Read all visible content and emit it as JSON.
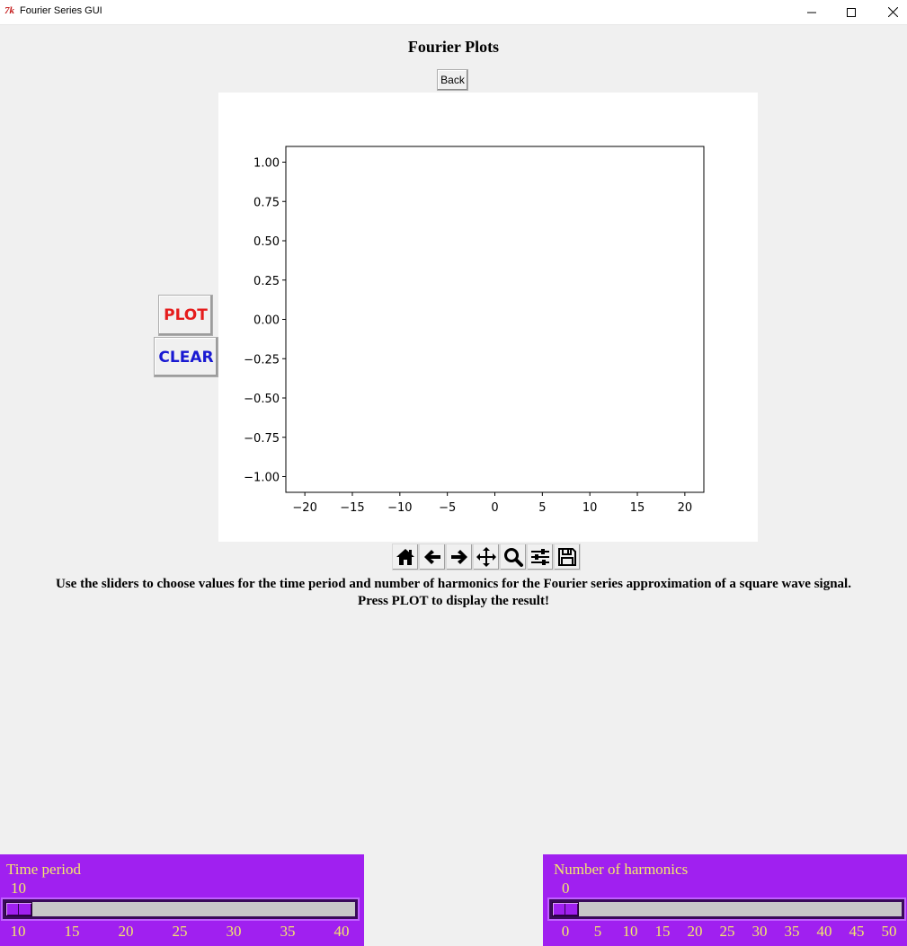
{
  "window": {
    "title": "Fourier Series GUI",
    "app_icon_text": "7k"
  },
  "heading": "Fourier Plots",
  "back_label": "Back",
  "plot_label": "PLOT",
  "clear_label": "CLEAR",
  "instructions": {
    "line1": "Use the sliders to choose values for the time period and number of harmonics for the Fourier series approximation of a square wave signal.",
    "line2": "Press PLOT to display the result!"
  },
  "toolbar": [
    "home-icon",
    "back-arrow-icon",
    "forward-arrow-icon",
    "pan-icon",
    "zoom-icon",
    "configure-subplots-icon",
    "save-icon"
  ],
  "colors": {
    "plot_button_text": "#e51c1c",
    "clear_button_text": "#1919d2",
    "slider_panel": "#a020f0",
    "slider_text": "#f2e96a"
  },
  "chart_data": {
    "type": "line",
    "title": "",
    "xlabel": "",
    "ylabel": "",
    "xlim": [
      -22,
      22
    ],
    "ylim": [
      -1.1,
      1.1
    ],
    "xticks": [
      -20,
      -15,
      -10,
      -5,
      0,
      5,
      10,
      15,
      20
    ],
    "yticks": [
      1.0,
      0.75,
      0.5,
      0.25,
      0.0,
      -0.25,
      -0.5,
      -0.75,
      -1.0
    ],
    "xtick_labels": [
      "−20",
      "−15",
      "−10",
      "−5",
      "0",
      "5",
      "10",
      "15",
      "20"
    ],
    "ytick_labels": [
      "1.00",
      "0.75",
      "0.50",
      "0.25",
      "0.00",
      "−0.25",
      "−0.50",
      "−0.75",
      "−1.00"
    ],
    "series": [],
    "grid": false
  },
  "sliders": {
    "time_period": {
      "label": "Time period",
      "value": "10",
      "min": 10,
      "max": 40,
      "ticks": [
        "10",
        "15",
        "20",
        "25",
        "30",
        "35",
        "40"
      ]
    },
    "harmonics": {
      "label": "Number of harmonics",
      "value": "0",
      "min": 0,
      "max": 50,
      "ticks": [
        "0",
        "5",
        "10",
        "15",
        "20",
        "25",
        "30",
        "35",
        "40",
        "45",
        "50"
      ]
    }
  }
}
